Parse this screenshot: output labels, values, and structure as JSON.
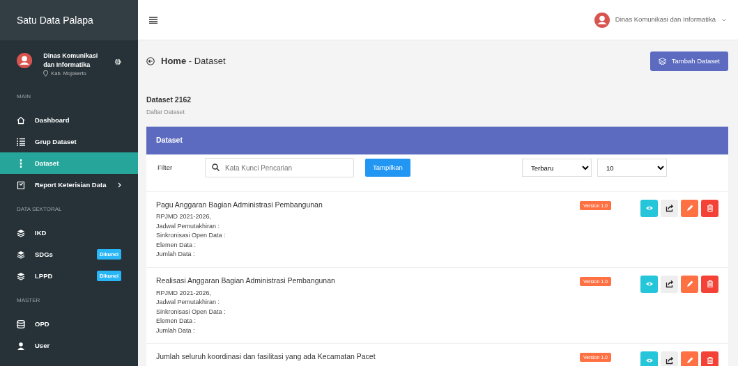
{
  "brand": "Satu Data Palapa",
  "profile": {
    "name": "Dinas Komunikasi dan Informatika",
    "location": "Kab. Mojokerto"
  },
  "sidebar": {
    "sections": [
      {
        "title": "MAIN",
        "items": [
          {
            "kind": "home",
            "label": "Dashboard",
            "selected": false
          },
          {
            "kind": "list",
            "label": "Grup Dataset",
            "selected": false
          },
          {
            "kind": "dots",
            "label": "Dataset",
            "selected": true
          },
          {
            "kind": "clipboard",
            "label": "Report Keterisian Data",
            "selected": false,
            "submenu": true
          }
        ]
      },
      {
        "title": "DATA SEKTORAL",
        "items": [
          {
            "kind": "layers",
            "label": "IKD",
            "selected": false
          },
          {
            "kind": "layers",
            "label": "SDGs",
            "selected": false,
            "badge": "Dikunci"
          },
          {
            "kind": "layers",
            "label": "LPPD",
            "selected": false,
            "badge": "Dikunci"
          }
        ]
      },
      {
        "title": "MASTER",
        "items": [
          {
            "kind": "database",
            "label": "OPD",
            "selected": false
          },
          {
            "kind": "user",
            "label": "User",
            "selected": false
          }
        ]
      }
    ]
  },
  "topbar": {
    "user": "Dinas Komunikasi dan Informatika"
  },
  "breadcrumb": {
    "home": "Home",
    "current": "- Dataset"
  },
  "add_button": "Tambah Dataset",
  "summary": {
    "title": "Dataset 2162",
    "subtitle": "Daftar Dataset"
  },
  "panel": {
    "title": "Dataset",
    "filter_label": "Filter",
    "search": {
      "placeholder": "Kata Kunci Pencarian"
    },
    "show_button": "Tampilkan",
    "sort": "Terbaru",
    "per_page": "10"
  },
  "datasets": [
    {
      "title": "Pagu Anggaran Bagian Administrasi Pembangunan",
      "version": "Version 1.0",
      "details": [
        "RPJMD 2021-2026,",
        "Jadwal Pemutakhiran :",
        "Sinkronisasi Open Data :",
        "Elemen Data :",
        "Jumlah Data :"
      ]
    },
    {
      "title": "Realisasi Anggaran Bagian Administrasi Pembangunan",
      "version": "Version 1.0",
      "details": [
        "RPJMD 2021-2026,",
        "Jadwal Pemutakhiran :",
        "Sinkronisasi Open Data :",
        "Elemen Data :",
        "Jumlah Data :"
      ]
    },
    {
      "title": "Jumlah seluruh koordinasi dan fasilitasi yang ada Kecamatan Pacet",
      "version": "Version 1.0"
    }
  ]
}
